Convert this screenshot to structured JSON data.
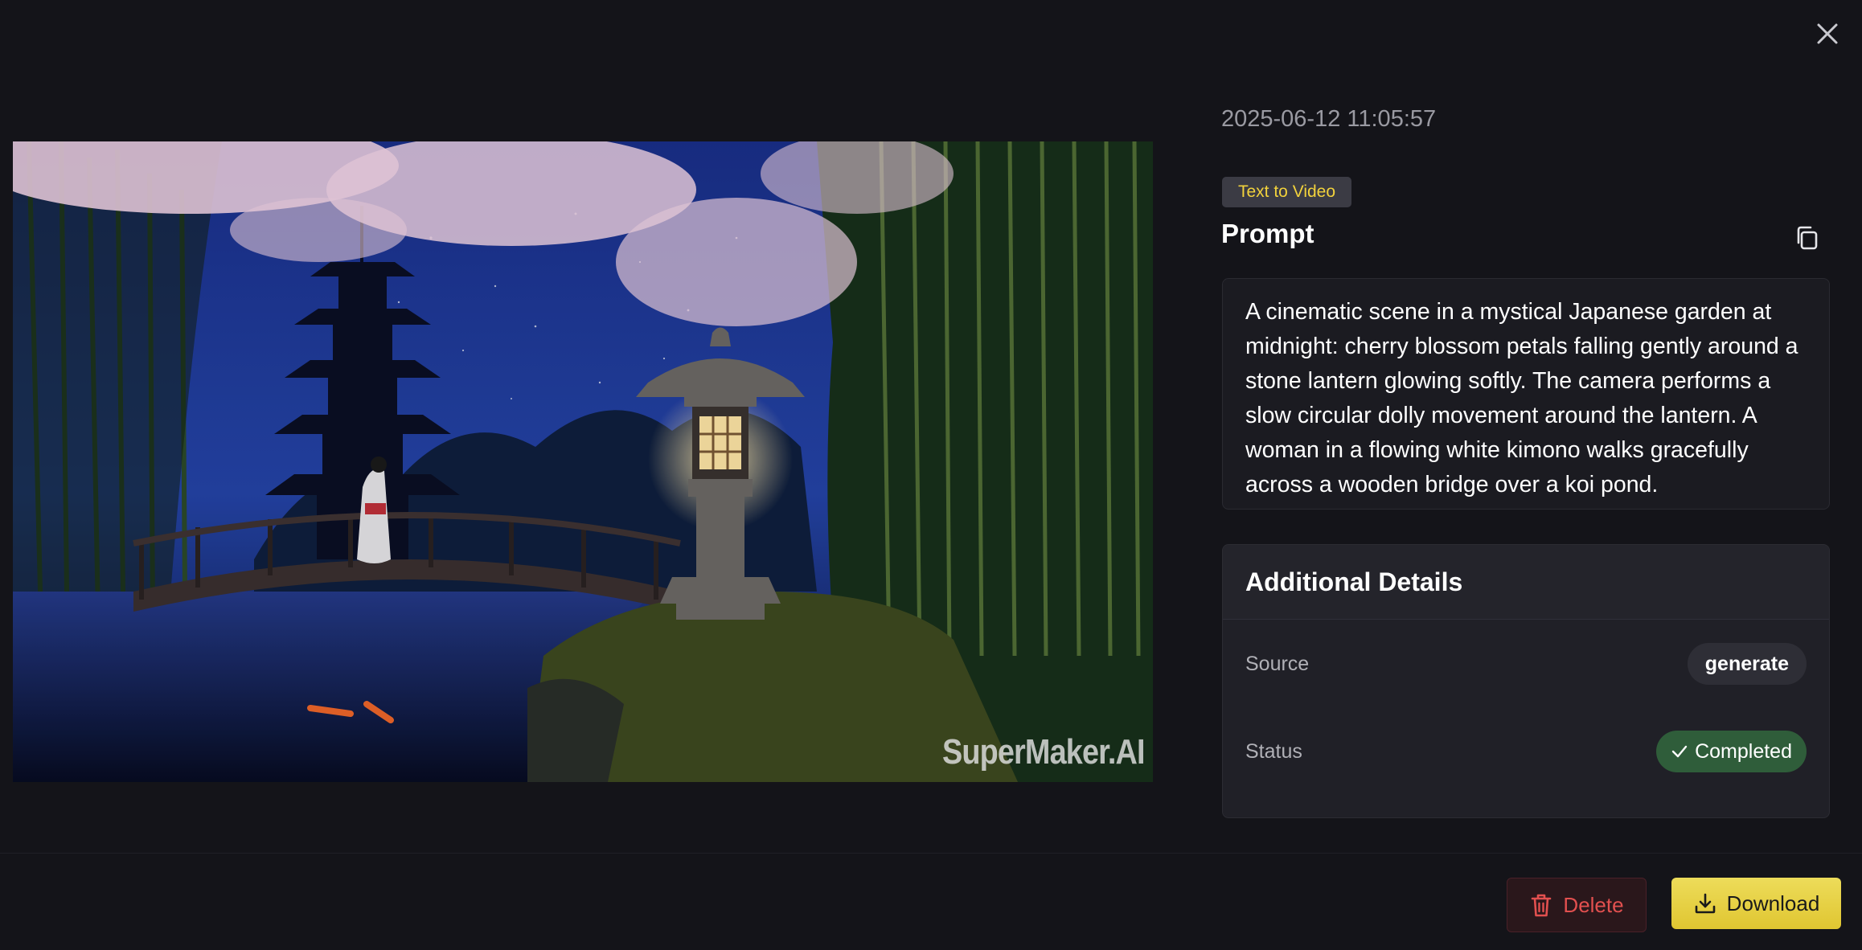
{
  "modal": {
    "close_icon": "close-icon",
    "media": {
      "watermark": "SuperMaker.AI"
    },
    "timestamp": "2025-06-12 11:05:57",
    "type_badge": "Text to Video",
    "prompt": {
      "title": "Prompt",
      "copy_icon": "copy-icon",
      "text": "A cinematic scene in a mystical Japanese garden at midnight: cherry blossom petals falling gently around a stone lantern glowing softly. The camera performs a slow circular dolly movement around the lantern. A woman in a flowing white kimono walks gracefully across a wooden bridge over a koi pond."
    },
    "details": {
      "title": "Additional Details",
      "rows": [
        {
          "label": "Source",
          "value": "generate"
        },
        {
          "label": "Status",
          "value": "Completed"
        }
      ]
    },
    "actions": {
      "delete_label": "Delete",
      "download_label": "Download"
    },
    "colors": {
      "background": "#141419",
      "accent_yellow": "#e6cf3a",
      "status_green": "#2f5d3a",
      "danger_red": "#e2504f"
    }
  }
}
